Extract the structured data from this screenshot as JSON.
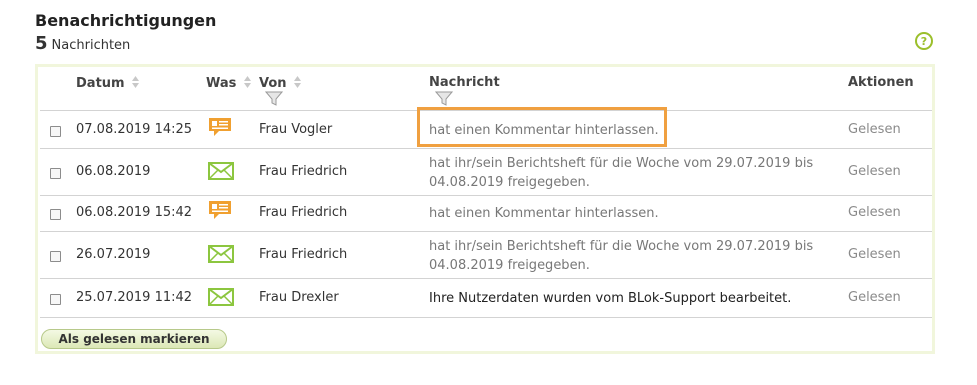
{
  "header": {
    "title": "Benachrichtigungen",
    "count": "5",
    "count_label": "Nachrichten",
    "help_icon": "?"
  },
  "table": {
    "columns": {
      "datum": "Datum",
      "was": "Was",
      "von": "Von",
      "nachricht": "Nachricht",
      "aktionen": "Aktionen"
    },
    "rows": [
      {
        "datum": "07.08.2019 14:25",
        "type": "comment-icon",
        "von": "Frau Vogler",
        "nachricht": "hat einen Kommentar hinterlassen.",
        "nachricht2": "",
        "aktion": "Gelesen"
      },
      {
        "datum": "06.08.2019",
        "type": "mail-icon",
        "von": "Frau Friedrich",
        "nachricht": "hat ihr/sein Berichtsheft für die Woche vom 29.07.2019 bis",
        "nachricht2": "04.08.2019 freigegeben.",
        "aktion": "Gelesen"
      },
      {
        "datum": "06.08.2019 15:42",
        "type": "comment-icon",
        "von": "Frau Friedrich",
        "nachricht": "hat einen Kommentar hinterlassen.",
        "nachricht2": "",
        "aktion": "Gelesen"
      },
      {
        "datum": "26.07.2019",
        "type": "mail-icon",
        "von": "Frau Friedrich",
        "nachricht": "hat ihr/sein Berichtsheft für die Woche vom 29.07.2019 bis",
        "nachricht2": "04.08.2019 freigegeben.",
        "aktion": "Gelesen"
      },
      {
        "datum": "25.07.2019 11:42",
        "type": "mail-icon",
        "von": "Frau Drexler",
        "nachricht": "Ihre Nutzerdaten wurden vom BLok-Support bearbeitet.",
        "nachricht2": "",
        "aktion": "Gelesen"
      }
    ]
  },
  "actions": {
    "mark_read": "Als gelesen markieren"
  },
  "colors": {
    "accent": "#9bbf2b",
    "highlight": "#f0a040",
    "comment_icon": "#f0a030",
    "mail_icon": "#8cc63f"
  }
}
